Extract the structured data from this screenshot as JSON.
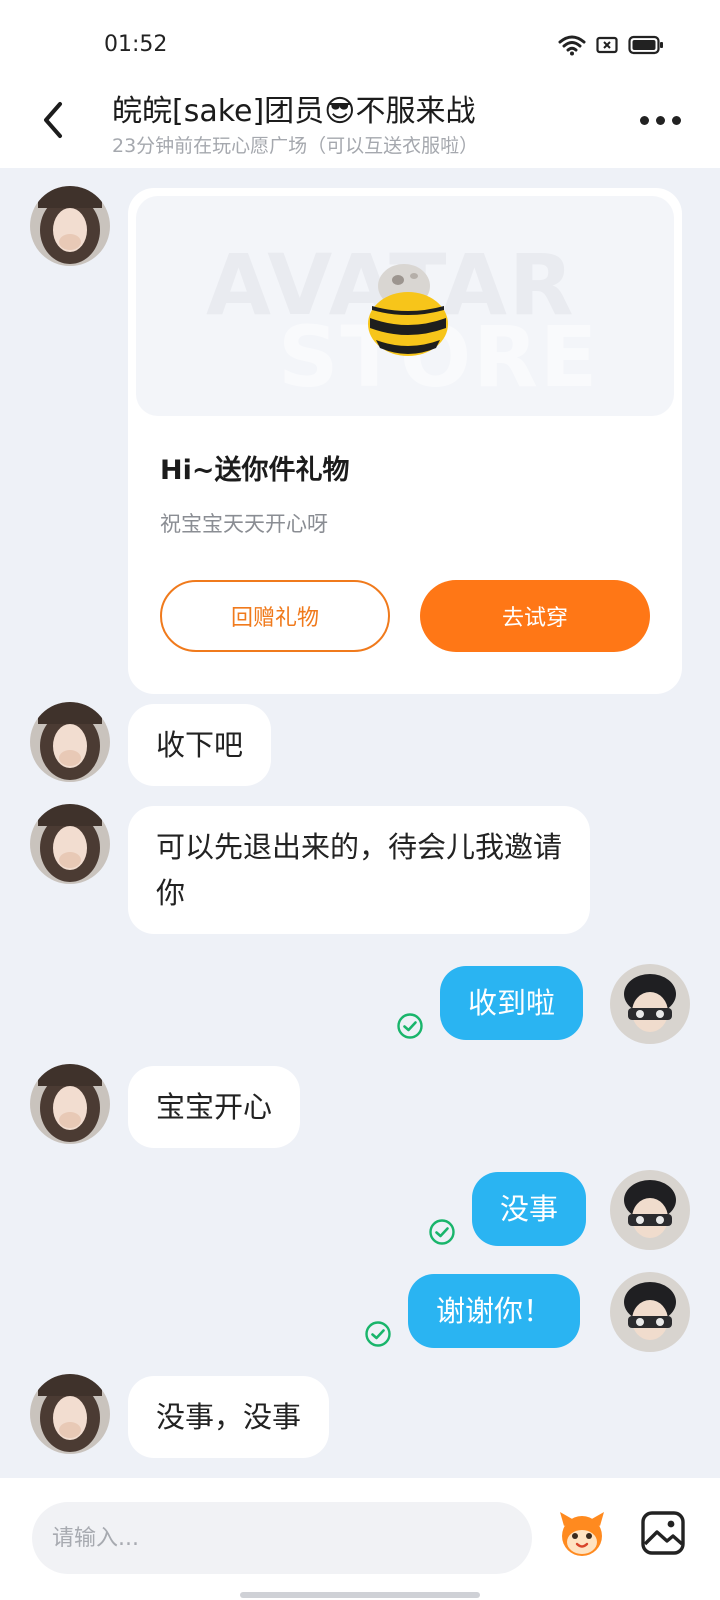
{
  "status_bar": {
    "time": "01:52",
    "icons": [
      "wifi-icon",
      "sim-icon",
      "battery-icon"
    ]
  },
  "header": {
    "title": "皖皖[sake]团员😎不服来战",
    "subtitle": "23分钟前在玩心愿广场（可以互送衣服啦）",
    "back_icon": "chevron-left-icon",
    "more_icon": "more-dots-icon"
  },
  "gift_card": {
    "watermark_line1": "AVATAR",
    "watermark_line2": "STORE",
    "title": "Hi~送你件礼物",
    "description": "祝宝宝天天开心呀",
    "return_gift_label": "回赠礼物",
    "try_on_label": "去试穿"
  },
  "messages": [
    {
      "side": "in",
      "text": "收下吧"
    },
    {
      "side": "in",
      "text": "可以先退出来的，待会儿我邀请你"
    },
    {
      "side": "out",
      "text": "收到啦",
      "read": true
    },
    {
      "side": "in",
      "text": "宝宝开心"
    },
    {
      "side": "out",
      "text": "没事",
      "read": true
    },
    {
      "side": "out",
      "text": "谢谢你！",
      "read": true
    },
    {
      "side": "in",
      "text": "没事，没事"
    }
  ],
  "composer": {
    "placeholder": "请输入...",
    "emoji_icon": "mascot-emoji-icon",
    "image_icon": "image-icon"
  },
  "colors": {
    "accent_orange": "#ff7716",
    "bubble_blue": "#2ab4f2",
    "read_check_green": "#19b56b",
    "background": "#eef1f7"
  }
}
